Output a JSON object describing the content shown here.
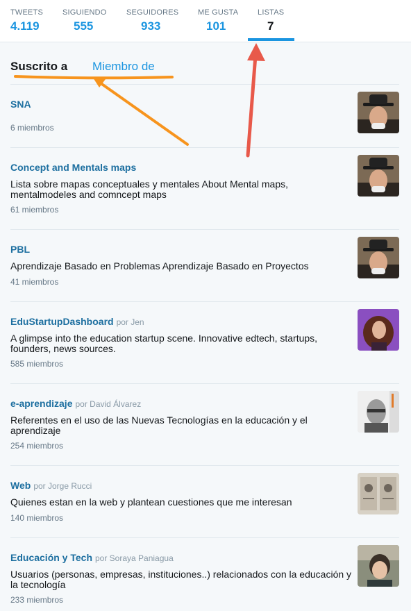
{
  "stats": [
    {
      "label": "TWEETS",
      "value": "4.119"
    },
    {
      "label": "SIGUIENDO",
      "value": "555"
    },
    {
      "label": "SEGUIDORES",
      "value": "933"
    },
    {
      "label": "ME GUSTA",
      "value": "101"
    },
    {
      "label": "LISTAS",
      "value": "7"
    }
  ],
  "subnav": {
    "subscribed_label": "Suscrito a",
    "member_label": "Miembro de"
  },
  "lists": [
    {
      "name": "SNA",
      "by": "",
      "description": "",
      "members": "6 miembros"
    },
    {
      "name": "Concept and Mentals maps",
      "by": "",
      "description": "Lista sobre mapas conceptuales y mentales About Mental maps, mentalmodeles and comncept maps",
      "members": "61 miembros"
    },
    {
      "name": "PBL",
      "by": "",
      "description": "Aprendizaje Basado en Problemas Aprendizaje Basado en Proyectos",
      "members": "41 miembros"
    },
    {
      "name": "EduStartupDashboard",
      "by": "por Jen",
      "description": "A glimpse into the education startup scene. Innovative edtech, startups, founders, news sources.",
      "members": "585 miembros"
    },
    {
      "name": "e-aprendizaje",
      "by": "por David Álvarez",
      "description": "Referentes en el uso de las Nuevas Tecnologías en la educación y el aprendizaje",
      "members": "254 miembros"
    },
    {
      "name": "Web",
      "by": "por Jorge Rucci",
      "description": "Quienes estan en la web y plantean cuestiones que me interesan",
      "members": "140 miembros"
    },
    {
      "name": "Educación y Tech",
      "by": "por Soraya Paniagua",
      "description": "Usuarios (personas, empresas, instituciones..) relacionados con la educación y la tecnología",
      "members": "233 miembros"
    }
  ],
  "colors": {
    "accent": "#1b95e0",
    "annotation_orange": "#f7941d",
    "annotation_red": "#e8594a"
  }
}
